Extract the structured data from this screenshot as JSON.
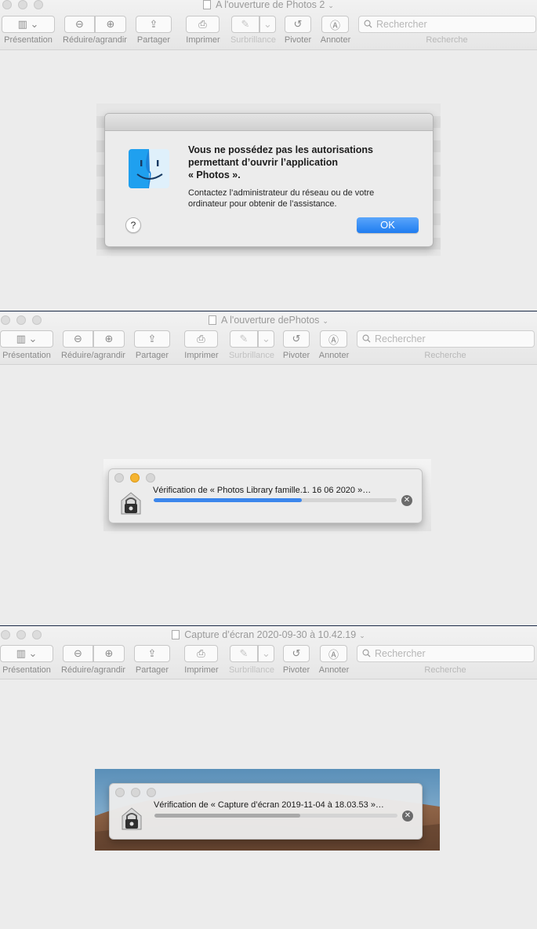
{
  "toolbar": {
    "presentation": "Présentation",
    "zoom": "Réduire/agrandir",
    "share": "Partager",
    "print": "Imprimer",
    "highlight": "Surbrillance",
    "rotate": "Pivoter",
    "annotate": "Annoter",
    "search_label": "Recherche",
    "search_placeholder": "Rechercher"
  },
  "windows": [
    {
      "title": "A l'ouverture de Photos 2"
    },
    {
      "title": "A l'ouverture dePhotos"
    },
    {
      "title": "Capture d’écran 2020-09-30 à 10.42.19"
    }
  ],
  "alert": {
    "title": "Vous ne possédez pas les autorisations\npermettant d’ouvrir l’application\n« Photos ».",
    "message": "Contactez l’administrateur du réseau ou de votre\nordinateur pour obtenir de l’assistance.",
    "help": "?",
    "ok": "OK"
  },
  "progress1": {
    "text": "Vérification de « Photos Library  famille.1. 16 06 2020 »…",
    "progress": 0.61,
    "color": "#3b86ec"
  },
  "progress2": {
    "text": "Vérification de « Capture d’écran 2019-11-04 à 18.03.53 »…",
    "progress": 0.6,
    "color": "#a9a9a9"
  },
  "colors": {
    "accent": "#1f7cf0"
  }
}
